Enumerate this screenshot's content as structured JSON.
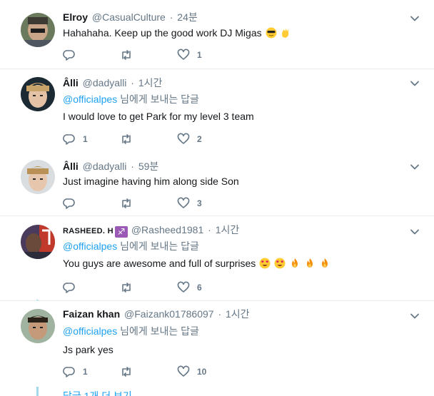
{
  "tweets": [
    {
      "name": "Elroy",
      "handle": "@CasualCulture",
      "time": "24분",
      "reply_prefix": "",
      "reply_mention": "",
      "reply_suffix": "",
      "text": "Hahahaha. Keep up the good work DJ Migas",
      "emojis": [
        "sunglasses-face",
        "waving-hand"
      ],
      "reply_count": "",
      "retweet_count": "",
      "like_count": "1"
    },
    {
      "name": "Âlli",
      "handle": "@dadyalli",
      "time": "1시간",
      "reply_mention": "@officialpes",
      "reply_suffix": " 님에게 보내는 답글",
      "text": "I would love to get Park for my level 3 team",
      "emojis": [],
      "reply_count": "1",
      "retweet_count": "",
      "like_count": "2"
    },
    {
      "name": "Âlli",
      "handle": "@dadyalli",
      "time": "59분",
      "reply_mention": "",
      "reply_suffix": "",
      "text": "Just imagine having him along side Son",
      "emojis": [],
      "reply_count": "",
      "retweet_count": "",
      "like_count": "3"
    },
    {
      "name": "RASHEED. H",
      "name_badge": "♐",
      "handle": "@Rasheed1981",
      "time": "1시간",
      "reply_mention": "@officialpes",
      "reply_suffix": " 님에게 보내는 답글",
      "text": "You guys are awesome and full of surprises",
      "emojis": [
        "heart-eyes",
        "heart-eyes",
        "fire",
        "fire",
        "fire"
      ],
      "reply_count": "",
      "retweet_count": "",
      "like_count": "6"
    },
    {
      "name": "Faizan khan",
      "handle": "@Faizank01786097",
      "time": "1시간",
      "reply_mention": "@officialpes",
      "reply_suffix": " 님에게 보내는 답글",
      "text": "Js park yes",
      "emojis": [],
      "reply_count": "1",
      "retweet_count": "",
      "like_count": "10"
    }
  ],
  "separator": "·",
  "more_replies": "답글 1개 더 보기",
  "colors": {
    "link": "#1da1f2",
    "muted": "#657786",
    "thread": "#a6d8ec",
    "divider": "#e6ecf0"
  },
  "icons": {
    "reply": "reply-icon",
    "retweet": "retweet-icon",
    "like": "heart-icon",
    "menu": "chevron-down-icon"
  }
}
